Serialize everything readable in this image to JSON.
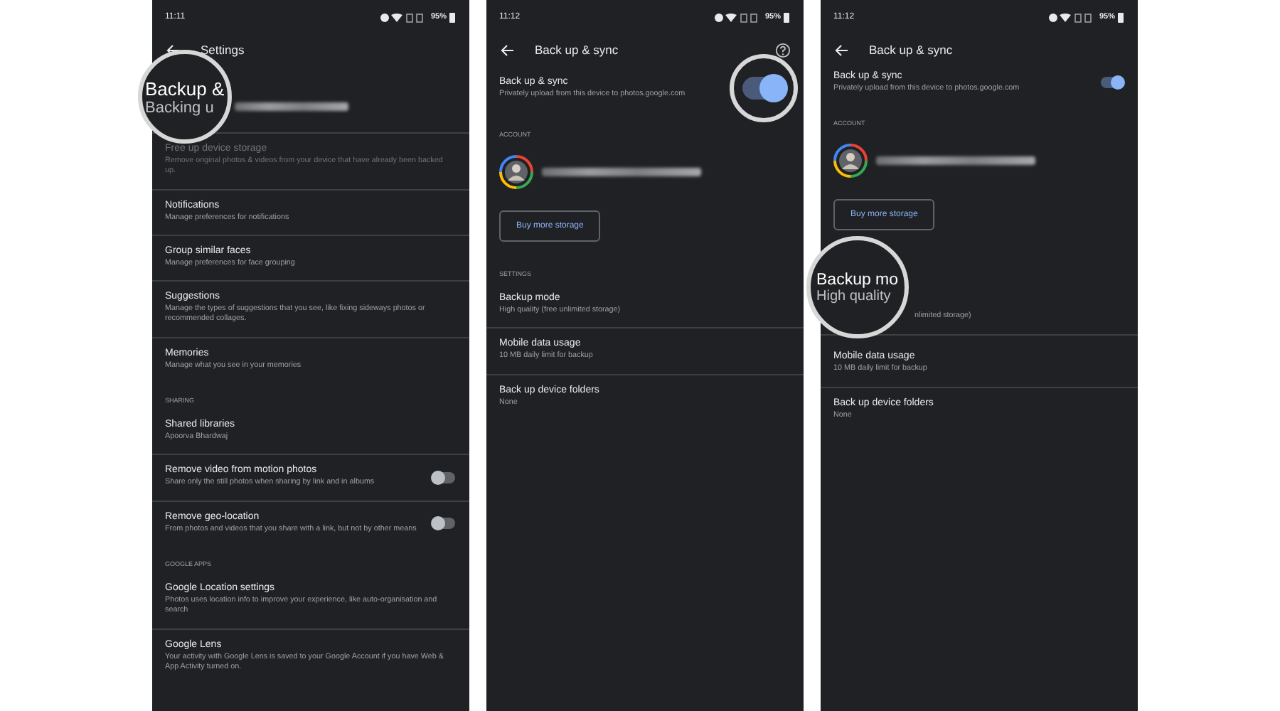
{
  "panels": [
    {
      "status": {
        "time": "11:11",
        "battery": "95%"
      },
      "header": {
        "title": "Settings",
        "help": false
      },
      "items": [
        {
          "kind": "lens-row",
          "lens_title": "Backup &",
          "lens_subtitle": "Backing u"
        },
        {
          "kind": "setting",
          "title": "Free up device storage",
          "subtitle": "Remove original photos & videos from your device that have already been backed up.",
          "disabled": true,
          "divider": true
        },
        {
          "kind": "setting",
          "title": "Notifications",
          "subtitle": "Manage preferences for notifications",
          "disabled": false,
          "divider": true
        },
        {
          "kind": "setting",
          "title": "Group similar faces",
          "subtitle": "Manage preferences for face grouping",
          "disabled": false,
          "divider": true
        },
        {
          "kind": "setting",
          "title": "Suggestions",
          "subtitle": "Manage the types of suggestions that you see, like fixing sideways photos or recommended collages.",
          "disabled": false,
          "divider": true
        },
        {
          "kind": "setting",
          "title": "Memories",
          "subtitle": "Manage what you see in your memories",
          "disabled": false,
          "divider": false
        },
        {
          "kind": "section",
          "title": "SHARING"
        },
        {
          "kind": "setting",
          "title": "Shared libraries",
          "subtitle": "Apoorva Bhardwaj",
          "disabled": false,
          "divider": true
        },
        {
          "kind": "toggle",
          "title": "Remove video from motion photos",
          "subtitle": "Share only the still photos when sharing by link and in albums",
          "on": false,
          "magnified": false,
          "divider": true
        },
        {
          "kind": "toggle",
          "title": "Remove geo-location",
          "subtitle": "From photos and videos that you share with a link, but not by other means",
          "on": false,
          "magnified": false,
          "divider": false
        },
        {
          "kind": "section",
          "title": "GOOGLE APPS"
        },
        {
          "kind": "setting",
          "title": "Google Location settings",
          "subtitle": "Photos uses location info to improve your experience, like auto-organisation and search",
          "disabled": false,
          "divider": true
        },
        {
          "kind": "setting",
          "title": "Google Lens",
          "subtitle": "Your activity with Google Lens is saved to your Google Account if you have Web & App Activity turned on.",
          "disabled": false,
          "divider": false
        }
      ]
    },
    {
      "status": {
        "time": "11:12",
        "battery": "95%"
      },
      "header": {
        "title": "Back up & sync",
        "help": true
      },
      "items": [
        {
          "kind": "toggle",
          "title": "Back up & sync",
          "subtitle": "Privately upload from this device to photos.google.com",
          "on": true,
          "magnified": true,
          "divider": false
        },
        {
          "kind": "section",
          "title": "ACCOUNT"
        },
        {
          "kind": "account"
        },
        {
          "kind": "button",
          "label": "Buy more storage"
        },
        {
          "kind": "section",
          "title": "SETTINGS"
        },
        {
          "kind": "setting",
          "title": "Backup mode",
          "subtitle": "High quality (free unlimited storage)",
          "disabled": false,
          "divider": true
        },
        {
          "kind": "setting",
          "title": "Mobile data usage",
          "subtitle": "10 MB daily limit for backup",
          "disabled": false,
          "divider": true
        },
        {
          "kind": "setting",
          "title": "Back up device folders",
          "subtitle": "None",
          "disabled": false,
          "divider": false
        }
      ]
    },
    {
      "status": {
        "time": "11:12",
        "battery": "95%"
      },
      "header": {
        "title": "Back up & sync",
        "help": false
      },
      "items": [
        {
          "kind": "toggle",
          "title": "Back up & sync",
          "subtitle": "Privately upload from this device to photos.google.com",
          "on": true,
          "magnified": false,
          "divider": false
        },
        {
          "kind": "section",
          "title": "ACCOUNT"
        },
        {
          "kind": "account"
        },
        {
          "kind": "button",
          "label": "Buy more storage"
        },
        {
          "kind": "lens-setting",
          "lens_title": "Backup mo",
          "lens_subtitle": "High quality",
          "subtitle_tail": "nlimited storage)",
          "divider": true
        },
        {
          "kind": "setting",
          "title": "Mobile data usage",
          "subtitle": "10 MB daily limit for backup",
          "disabled": false,
          "divider": true
        },
        {
          "kind": "setting",
          "title": "Back up device folders",
          "subtitle": "None",
          "disabled": false,
          "divider": false
        }
      ]
    }
  ]
}
